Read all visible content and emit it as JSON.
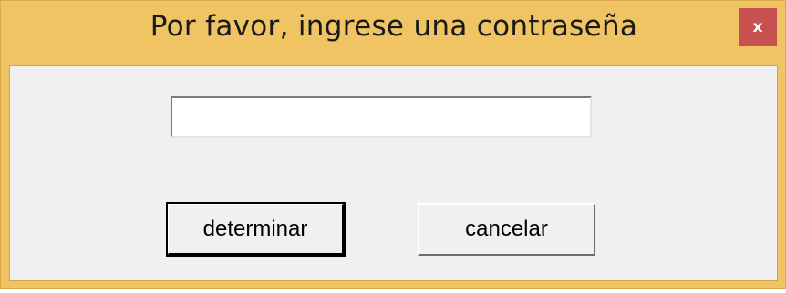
{
  "window": {
    "title": "Por favor, ingrese una contraseña",
    "close_label": "x"
  },
  "form": {
    "password_value": "",
    "ok_label": "determinar",
    "cancel_label": "cancelar"
  },
  "colors": {
    "titlebar": "#f0c463",
    "close_button": "#c75050",
    "client_background": "#f0f0f0"
  }
}
